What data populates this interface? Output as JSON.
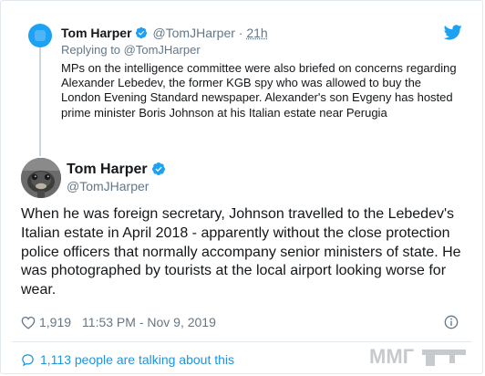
{
  "parent_tweet": {
    "author_name": "Tom Harper",
    "handle": "@TomJHarper",
    "separator": "·",
    "time": "21h",
    "replying_to": "Replying to @TomJHarper",
    "text": "MPs on the intelligence committee were also briefed on concerns regarding Alexander Lebedev, the former KGB spy who was allowed to buy the London Evening Standard newspaper. Alexander's son Evgeny has hosted prime minister Boris Johnson at his Italian estate near Perugia"
  },
  "main_tweet": {
    "author_name": "Tom Harper",
    "handle": "@TomJHarper",
    "text": "When he was foreign secretary, Johnson travelled to the Lebedev's Italian estate in April 2018 - apparently without the close protection police officers that normally accompany senior ministers of state. He was photographed by tourists at the local airport looking worse for wear.",
    "likes": "1,919",
    "timestamp": "11:53 PM - Nov 9, 2019",
    "talking_about": "1,113 people are talking about this"
  },
  "watermark": {
    "text": "ММГ"
  },
  "colors": {
    "twitter_blue": "#1da1f2",
    "link_blue": "#1b95e0",
    "secondary_text": "#657786",
    "primary_text": "#14171a",
    "border": "#e1e8ed"
  },
  "icons": [
    "twitter-bird-icon",
    "verified-badge-icon",
    "heart-icon",
    "info-icon",
    "speech-bubble-icon"
  ]
}
